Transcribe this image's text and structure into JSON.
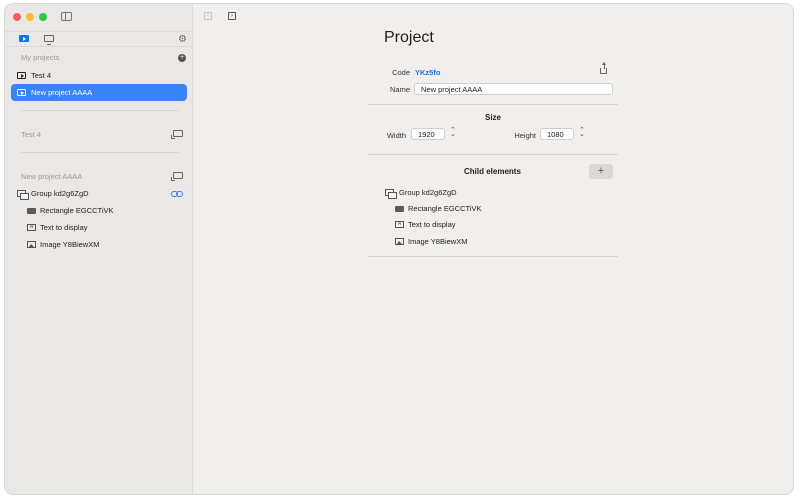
{
  "sidebar": {
    "my_projects_label": "My projects",
    "projects": [
      {
        "label": "Test 4",
        "selected": false
      },
      {
        "label": "New project AAAA",
        "selected": true
      }
    ],
    "section2_title": "Test 4",
    "section3_title": "New project AAAA",
    "tree": [
      {
        "label": "Group kd2g6ZgD",
        "icon": "group-icon"
      },
      {
        "label": "Rectangle EGCCTiVK",
        "icon": "rectangle-icon"
      },
      {
        "label": "Text to display",
        "icon": "text-icon"
      },
      {
        "label": "Image Y8BiewXM",
        "icon": "image-icon"
      }
    ],
    "text_icon_glyph": "A"
  },
  "main": {
    "title": "Project",
    "code_label": "Code",
    "code_value": "YKz5fo",
    "name_label": "Name",
    "name_value": "New project AAAA",
    "size_title": "Size",
    "width_label": "Width",
    "width_value": "1920",
    "height_label": "Height",
    "height_value": "1080",
    "children_title": "Child elements",
    "add_child_label": "+",
    "children": [
      {
        "label": "Group kd2g6ZgD"
      },
      {
        "label": "Rectangle EGCCTiVK"
      },
      {
        "label": "Text to display"
      },
      {
        "label": "Image Y8BiewXM"
      }
    ]
  },
  "colors": {
    "accent": "#3a82f7",
    "code_link": "#1a6fd8"
  }
}
